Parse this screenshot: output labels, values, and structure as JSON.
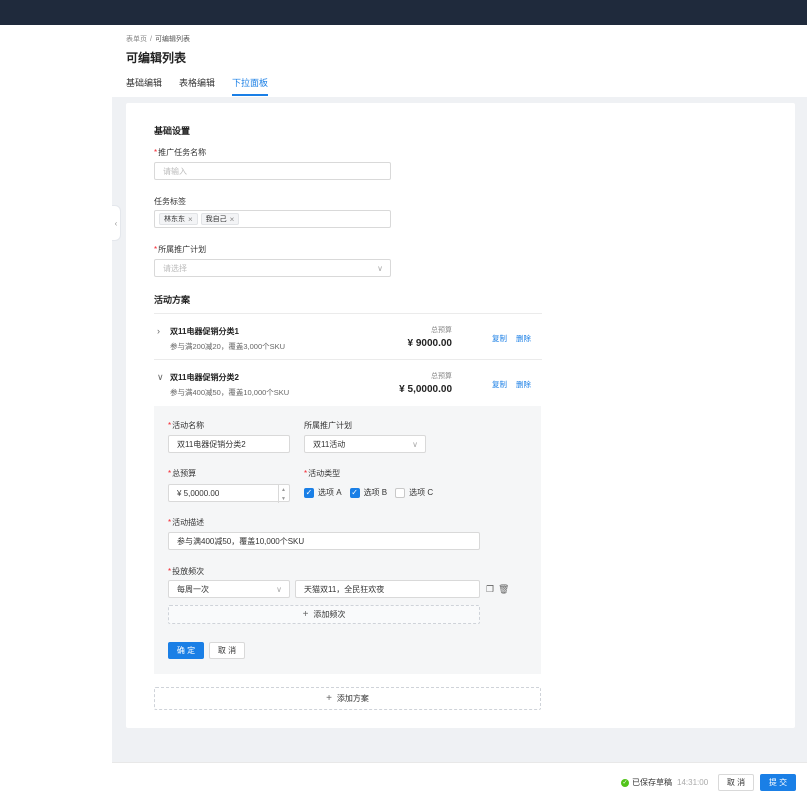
{
  "breadcrumb": {
    "home": "表单页",
    "separator": "/",
    "current": "可编辑列表"
  },
  "page_title": "可编辑列表",
  "tabs": [
    {
      "label": "基础编辑",
      "active": false
    },
    {
      "label": "表格编辑",
      "active": false
    },
    {
      "label": "下拉面板",
      "active": true
    }
  ],
  "basic": {
    "section_title": "基础设置",
    "task_name": {
      "label": "推广任务名称",
      "required_mark": "*",
      "placeholder": "请输入"
    },
    "task_tags": {
      "label": "任务标签",
      "tags": [
        "林东东",
        "我自己"
      ]
    },
    "plan_select": {
      "label": "所属推广计划",
      "required_mark": "*",
      "placeholder": "请选择"
    }
  },
  "activity": {
    "section_title": "活动方案",
    "plans": [
      {
        "name": "双11电器促销分类1",
        "desc": "参与满200减20，覆盖3,000个SKU",
        "budget_label": "总预算",
        "budget": "¥ 9000.00",
        "copy": "复制",
        "delete": "删除",
        "expanded": false
      },
      {
        "name": "双11电器促销分类2",
        "desc": "参与满400减50，覆盖10,000个SKU",
        "budget_label": "总预算",
        "budget": "¥ 5,0000.00",
        "copy": "复制",
        "delete": "删除",
        "expanded": true
      }
    ],
    "form": {
      "name_label": "活动名称",
      "name_value": "双11电器促销分类2",
      "plan_label": "所属推广计划",
      "plan_value": "双11活动",
      "budget_label": "总预算",
      "budget_value": "¥ 5,0000.00",
      "type_label": "活动类型",
      "type_options": [
        {
          "label": "选项 A",
          "checked": true
        },
        {
          "label": "选项 B",
          "checked": true
        },
        {
          "label": "选项 C",
          "checked": false
        }
      ],
      "desc_label": "活动描述",
      "desc_value": "参与满400减50，覆盖10,000个SKU",
      "freq_label": "投放频次",
      "freq_value": "每周一次",
      "freq_text": "天猫双11，全民狂欢夜",
      "add_freq": "添加频次",
      "confirm": "确 定",
      "cancel": "取 消",
      "required_mark": "*"
    },
    "add_plan": "添加方案"
  },
  "footer": {
    "saved_text": "已保存草稿",
    "saved_time": "14:31:00",
    "cancel": "取 消",
    "submit": "提 交"
  },
  "colors": {
    "primary": "#1a7fe6",
    "topbar": "#1f2a3c",
    "success": "#52c41a",
    "required": "#f5222d"
  }
}
